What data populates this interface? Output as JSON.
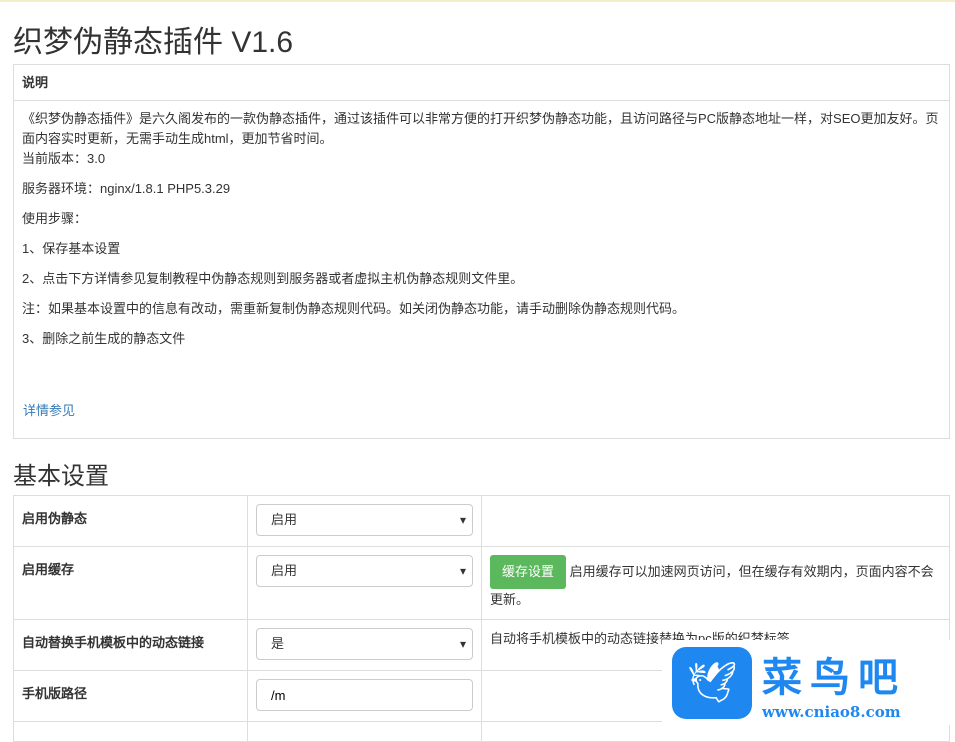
{
  "title": "织梦伪静态插件 V1.6",
  "panel": {
    "header": "说明",
    "intro": "《织梦伪静态插件》是六久阁发布的一款伪静态插件，通过该插件可以非常方便的打开织梦伪静态功能，且访问路径与PC版静态地址一样，对SEO更加友好。页面内容实时更新，无需手动生成html，更加节省时间。",
    "version": "当前版本：3.0",
    "env": "服务器环境：nginx/1.8.1 PHP5.3.29",
    "steps_title": "使用步骤：",
    "step1": "1、保存基本设置",
    "step2": "2、点击下方详情参见复制教程中伪静态规则到服务器或者虚拟主机伪静态规则文件里。",
    "note": "注：如果基本设置中的信息有改动，需重新复制伪静态规则代码。如关闭伪静态功能，请手动删除伪静态规则代码。",
    "step3": "3、删除之前生成的静态文件",
    "link": "详情参见"
  },
  "section": "基本设置",
  "rows": [
    {
      "label": "启用伪静态",
      "value": "启用",
      "desc": ""
    },
    {
      "label": "启用缓存",
      "value": "启用",
      "button": "缓存设置",
      "desc": "启用缓存可以加速网页访问，但在缓存有效期内，页面内容不会更新。"
    },
    {
      "label": "自动替换手机模板中的动态链接",
      "value": "是",
      "desc": "自动将手机模板中的动态链接替换为pc版的织梦标签"
    },
    {
      "label": "手机版路径",
      "value": "/m",
      "desc": ""
    }
  ],
  "watermark": {
    "name": "菜鸟吧",
    "url": "www.cniao8.com"
  }
}
